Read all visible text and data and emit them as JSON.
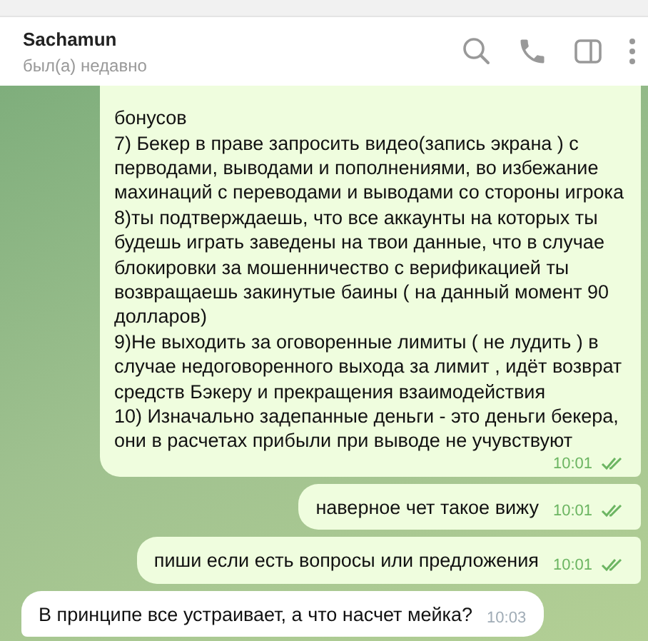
{
  "header": {
    "name": "Sachamun",
    "status": "был(а) недавно"
  },
  "messages": [
    {
      "kind": "outgoing",
      "lines": [
        "бонусов",
        "7) Бекер в праве запросить видео(запись экрана ) с",
        "перводами, выводами и пополнениями, во избежание",
        "махинаций с переводами и выводами со стороны игрока",
        "8)ты подтверждаешь, что все аккаунты на которых ты",
        "будешь играть заведены на твои данные, что в случае",
        "блокировки за мошенничество с верификацией ты",
        "возвращаешь закинутые баины ( на данный момент 90",
        "долларов)",
        "9)Не выходить за оговоренные лимиты ( не лудить ) в",
        "случае недоговоренного выхода за лимит , идёт возврат",
        "средств Бэкеру и прекращения взаимодействия",
        "10) Изначально задепанные деньги - это деньги бекера,",
        "они в расчетах прибыли при выводе не учувствуют"
      ],
      "time": "10:01",
      "read": true
    },
    {
      "kind": "outgoing",
      "lines": [
        "наверное чет такое вижу"
      ],
      "time": "10:01",
      "read": true
    },
    {
      "kind": "outgoing",
      "lines": [
        "пиши если есть вопросы или предложения"
      ],
      "time": "10:01",
      "read": true
    },
    {
      "kind": "incoming",
      "lines": [
        "В принципе все устраивает, а что насчет мейка?"
      ],
      "time": "10:03"
    }
  ]
}
